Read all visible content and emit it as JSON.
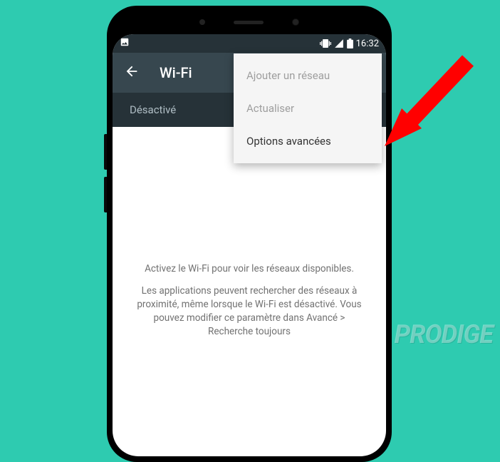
{
  "status_bar": {
    "time": "16:32"
  },
  "app_bar": {
    "title": "Wi-Fi"
  },
  "toggle": {
    "label": "Désactivé"
  },
  "menu": {
    "items": [
      {
        "label": "Ajouter un réseau",
        "enabled": false
      },
      {
        "label": "Actualiser",
        "enabled": false
      },
      {
        "label": "Options avancées",
        "enabled": true
      }
    ]
  },
  "content": {
    "line1": "Activez le Wi-Fi pour voir les réseaux disponibles.",
    "line2": "Les applications peuvent rechercher des réseaux à proximité, même lorsque le Wi-Fi est désactivé. Vous pouvez modifier ce paramètre dans Avancé > Recherche toujours"
  },
  "watermark": "PRODIGE"
}
